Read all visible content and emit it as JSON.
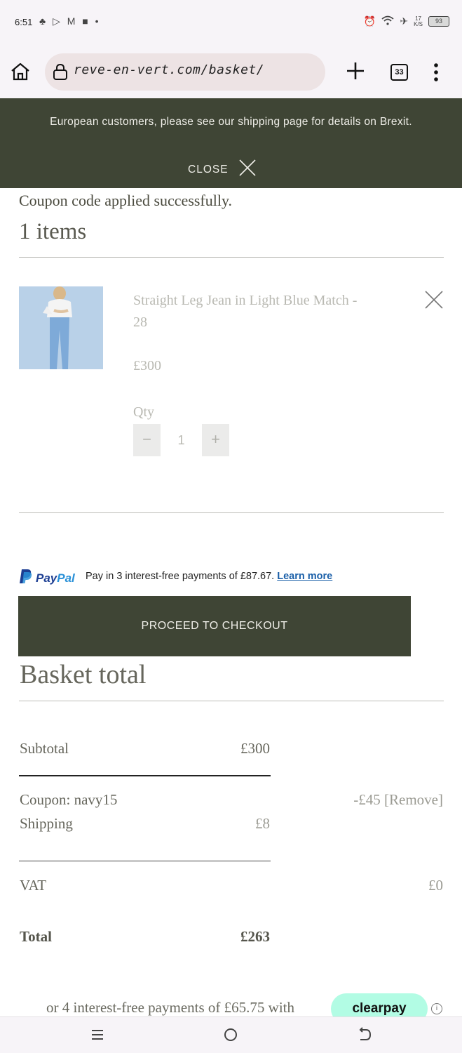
{
  "status_bar": {
    "time": "6:51",
    "left_icons": "♣ ▷ M ■ •",
    "speed_top": "17",
    "speed_unit": "K/S",
    "battery": "93"
  },
  "browser": {
    "url": "reve-en-vert.com/basket/",
    "tab_count": "33"
  },
  "banner": {
    "message": "European customers, please see our shipping page for details on Brexit.",
    "close_label": "CLOSE"
  },
  "basket": {
    "notice": "Coupon code applied successfully.",
    "items_heading": "1 items",
    "item": {
      "name": "Straight Leg Jean in Light Blue Match - 28",
      "price": "£300",
      "qty_label": "Qty",
      "qty": "1",
      "minus": "−",
      "plus": "+"
    }
  },
  "paypal": {
    "logo_pay": "Pay",
    "logo_pal": "Pal",
    "message": "Pay in 3 interest-free payments of £87.67.",
    "learn_more": "Learn more"
  },
  "checkout": {
    "button_label": "PROCEED TO CHECKOUT"
  },
  "totals": {
    "heading": "Basket total",
    "subtotal_label": "Subtotal",
    "subtotal_value": "£300",
    "coupon_label": "Coupon: navy15",
    "coupon_value": "-£45",
    "coupon_remove": "[Remove]",
    "shipping_label": "Shipping",
    "shipping_value": "£8",
    "vat_label": "VAT",
    "vat_value": "£0",
    "total_label": "Total",
    "total_value": "£263"
  },
  "clearpay": {
    "message": "or 4 interest-free payments of £65.75 with",
    "badge": "clearpay",
    "info": "i"
  },
  "colors": {
    "banner_bg": "#3f4535",
    "clearpay_bg": "#b2fce4",
    "paypal_blue": "#1d3f93"
  },
  "icons": [
    "home-icon",
    "lock-icon",
    "plus-icon",
    "tabs-icon",
    "more-vert-icon",
    "close-icon",
    "remove-item-icon",
    "paypal-icon",
    "info-icon",
    "nav-menu-icon",
    "nav-home-icon",
    "nav-back-icon"
  ]
}
